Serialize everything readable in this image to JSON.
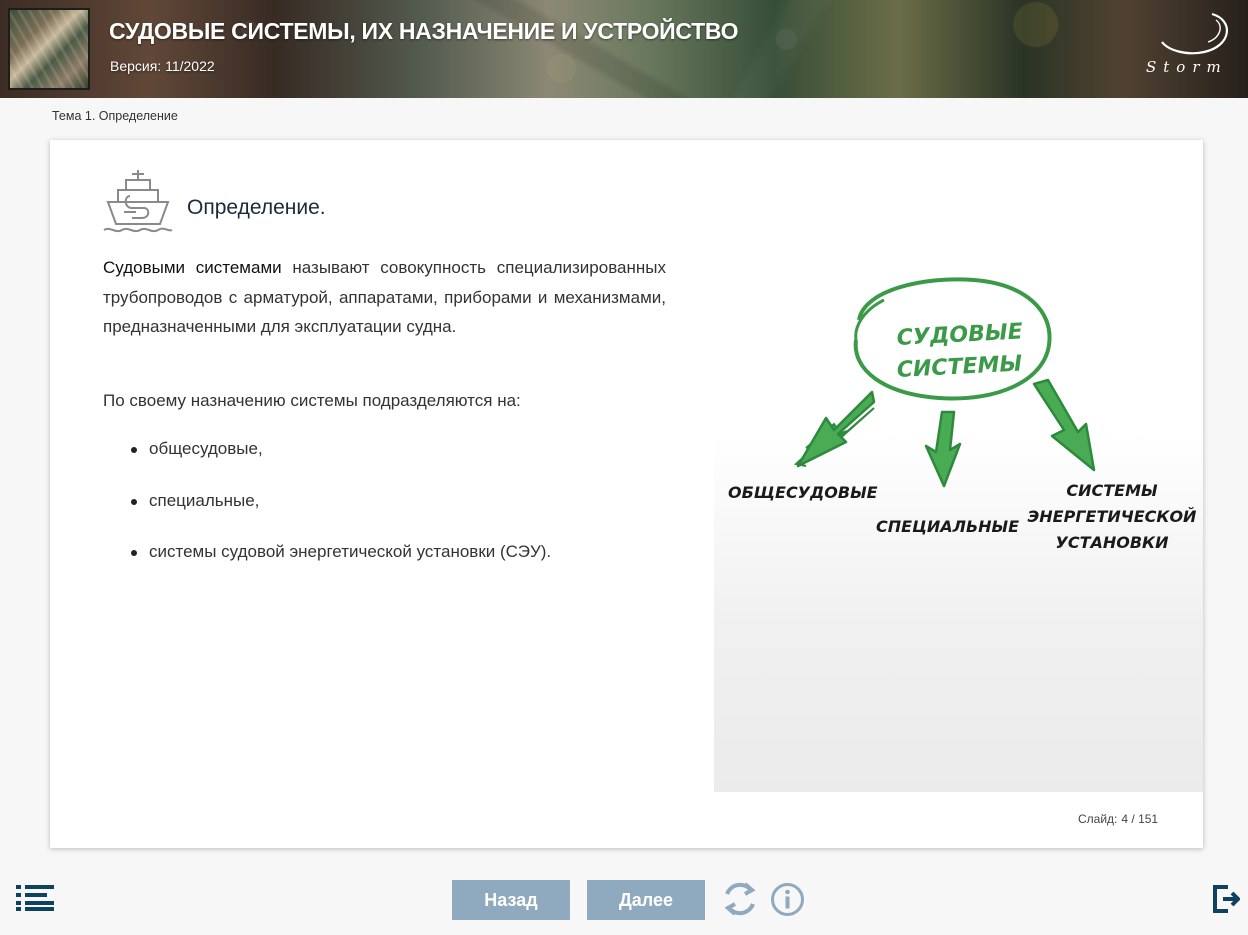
{
  "header": {
    "title": "СУДОВЫЕ СИСТЕМЫ, ИХ НАЗНАЧЕНИЕ И УСТРОЙСТВО",
    "version": "Версия: 11/2022",
    "logo_text": "Storm"
  },
  "breadcrumb": "Тема 1. Определение",
  "slide": {
    "heading": "Определение.",
    "intro_bold": "Судовыми системами",
    "intro_rest": " называют совокупность специализированных трубопроводов с арматурой, аппаратами, приборами и механизмами, предназначенными для эксплуатации судна.",
    "subtitle": "По своему назначению системы подразделяются на:",
    "list_items": [
      "общесудовые,",
      "специальные,",
      "системы судовой энергетической установки (СЭУ)."
    ],
    "counter_label": "Слайд:",
    "counter_value": "4 / 151"
  },
  "diagram": {
    "center_line1": "СУДОВЫЕ",
    "center_line2": "СИСТЕМЫ",
    "left": "ОБЩЕСУДОВЫЕ",
    "middle": "СПЕЦИАЛЬНЫЕ",
    "right_line1": "СИСТЕМЫ",
    "right_line2": "ЭНЕРГЕТИЧЕСКОЙ",
    "right_line3": "УСТАНОВКИ",
    "accent_color": "#3a9a48"
  },
  "footer": {
    "back_label": "Назад",
    "next_label": "Далее"
  },
  "colors": {
    "button_bg": "#8fa9be",
    "icon_dark": "#0f4160",
    "icon_muted": "#8fa9be"
  }
}
